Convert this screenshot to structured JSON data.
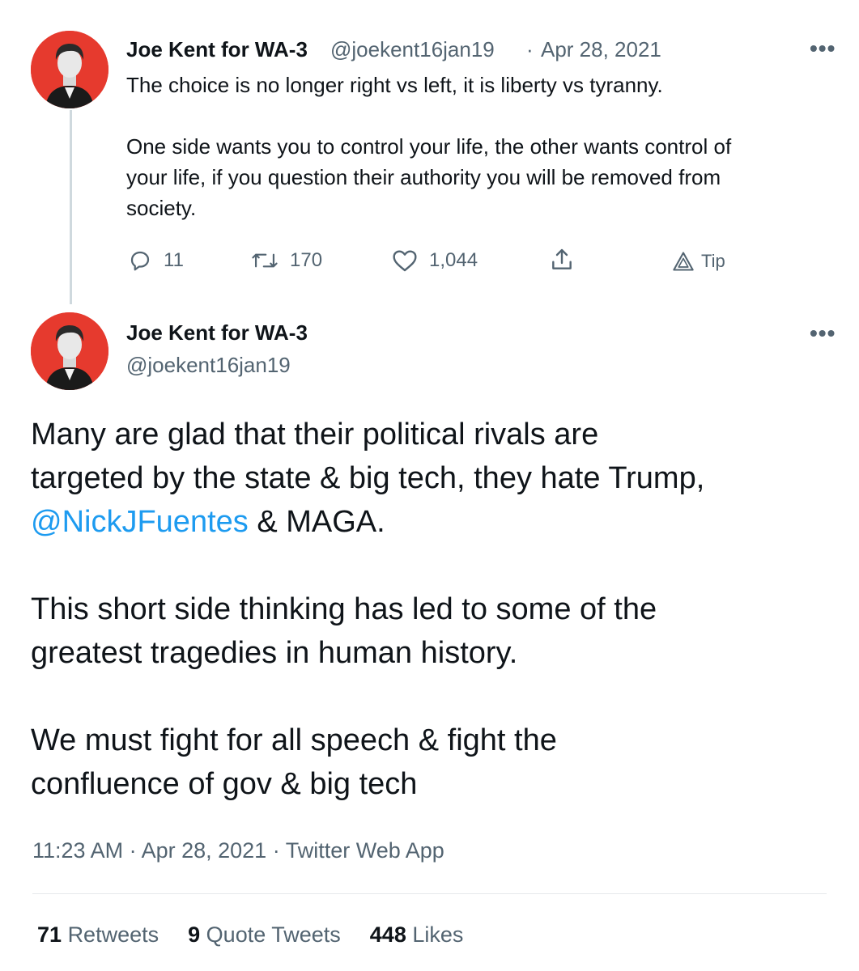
{
  "reply_tweet": {
    "author_name": "Joe Kent for WA-3",
    "handle": "@joekent16jan19",
    "separator": "·",
    "date": "Apr 28, 2021",
    "more_label": "•••",
    "paragraph1": "The choice is no longer right vs left, it is liberty vs tyranny.",
    "paragraph2_line1": "One side wants you to control your life, the other wants control of",
    "paragraph2_line2": "your life, if you question their authority you will be removed from",
    "paragraph2_line3": "society.",
    "replies": "11",
    "retweets": "170",
    "likes": "1,044",
    "tip_label": "Tip"
  },
  "main_tweet": {
    "author_name": "Joe Kent for WA-3",
    "handle": "@joekent16jan19",
    "more_label": "•••",
    "p1_line1": "Many are glad that their political rivals are",
    "p1_line2": "targeted by the state & big tech, they hate Trump,",
    "mention": "@NickJFuentes",
    "p1_line3_rest": " & MAGA.",
    "p2_line1": "This short side thinking has led to some of the",
    "p2_line2": "greatest tragedies in human history.",
    "p3_line1": "We must fight for all speech & fight the",
    "p3_line2": "confluence of gov & big tech",
    "timestamp": "11:23 AM · Apr 28, 2021 · Twitter Web App",
    "stats": {
      "retweets_count": "71",
      "retweets_label": "Retweets",
      "quotes_count": "9",
      "quotes_label": "Quote Tweets",
      "likes_count": "448",
      "likes_label": "Likes"
    }
  },
  "colors": {
    "avatar_bg": "#e63a2e",
    "link": "#1d9bf0",
    "muted": "#536471",
    "text": "#0f1419"
  }
}
